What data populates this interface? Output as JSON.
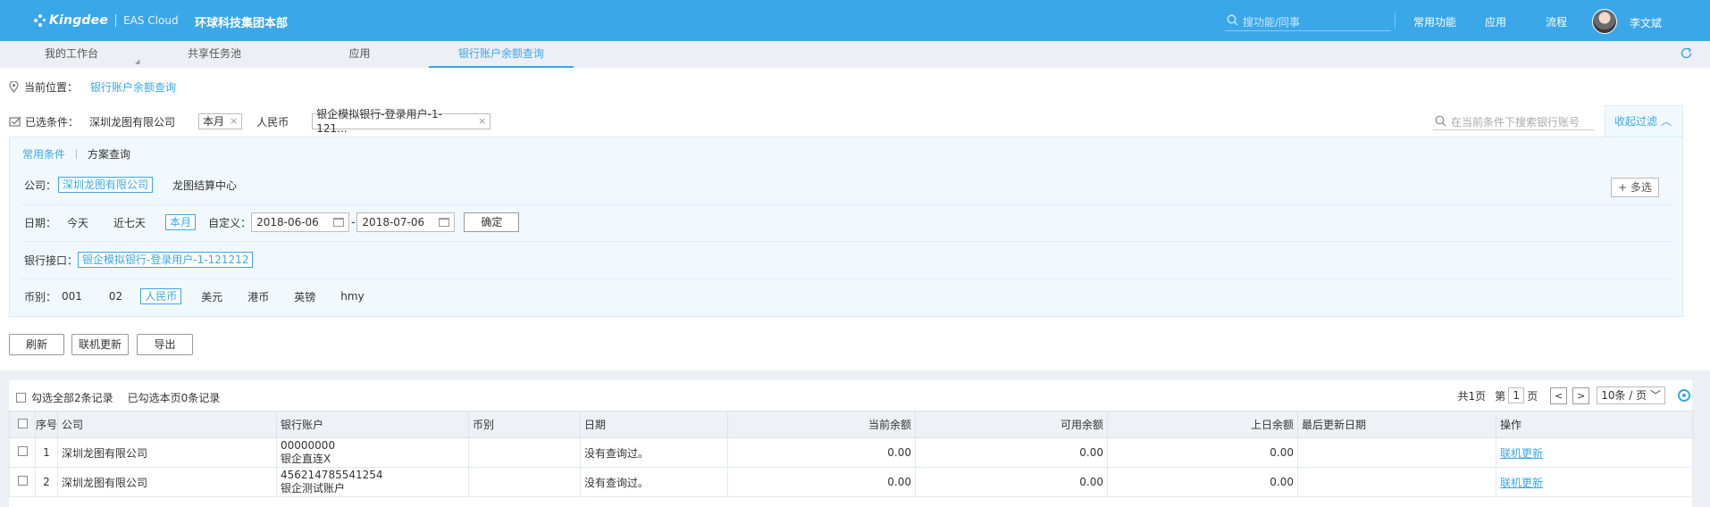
{
  "header": {
    "brand": "Kingdee",
    "product": "EAS Cloud",
    "org": "环球科技集团本部",
    "search_placeholder": "搜功能/同事",
    "nav": [
      "常用功能",
      "应用",
      "流程"
    ],
    "user": "李文斌"
  },
  "tabs": [
    {
      "label": "我的工作台"
    },
    {
      "label": "共享任务池"
    },
    {
      "label": "应用"
    },
    {
      "label": "银行账户余额查询",
      "active": true
    }
  ],
  "location": {
    "label": "当前位置：",
    "value": "银行账户余额查询"
  },
  "selected": {
    "label": "已选条件：",
    "company": "深圳龙图有限公司",
    "period": "本月",
    "currency": "人民币",
    "bank": "银企模拟银行-登录用户-1-121...",
    "search_placeholder": "在当前条件下搜索银行账号",
    "collapse_label": "收起过滤"
  },
  "filter": {
    "tabs": [
      "常用条件",
      "方案查询"
    ],
    "company": {
      "label": "公司：",
      "selected": "深圳龙图有限公司",
      "other": "龙图结算中心",
      "multi": "+ 多选"
    },
    "date": {
      "label": "日期：",
      "options": [
        "今天",
        "近七天"
      ],
      "selected": "本月",
      "custom_label": "自定义：",
      "from": "2018-06-06",
      "to": "2018-07-06",
      "ok": "确定"
    },
    "bank": {
      "label": "银行接口：",
      "selected": "银企模拟银行-登录用户-1-121212"
    },
    "currency": {
      "label": "币别：",
      "options_before": [
        "001",
        "02"
      ],
      "selected": "人民币",
      "options_after": [
        "美元",
        "港币",
        "英镑",
        "hmy"
      ]
    }
  },
  "actions": [
    "刷新",
    "联机更新",
    "导出"
  ],
  "grid": {
    "select_all": "勾选全部2条记录",
    "selected_page": "已勾选本页0条记录",
    "pager": {
      "total": "共1页",
      "page_prefix": "第",
      "page": "1",
      "page_suffix": "页",
      "size": "10条 / 页"
    },
    "columns": [
      "序号",
      "公司",
      "银行账户",
      "币别",
      "日期",
      "当前余额",
      "可用余额",
      "上日余额",
      "最后更新日期",
      "操作"
    ],
    "rows": [
      {
        "no": "1",
        "company": "深圳龙图有限公司",
        "account": "00000000",
        "account_name": "银企直连X",
        "currency": "",
        "date": "没有查询过。",
        "balance": "0.00",
        "available": "0.00",
        "prev": "0.00",
        "updated": "",
        "op": "联机更新"
      },
      {
        "no": "2",
        "company": "深圳龙图有限公司",
        "account": "456214785541254",
        "account_name": "银企测试账户",
        "currency": "",
        "date": "没有查询过。",
        "balance": "0.00",
        "available": "0.00",
        "prev": "0.00",
        "updated": "",
        "op": "联机更新"
      }
    ]
  },
  "colors": {
    "accent": "#3aa7e8",
    "panel_bg": "#f2f9fe"
  }
}
